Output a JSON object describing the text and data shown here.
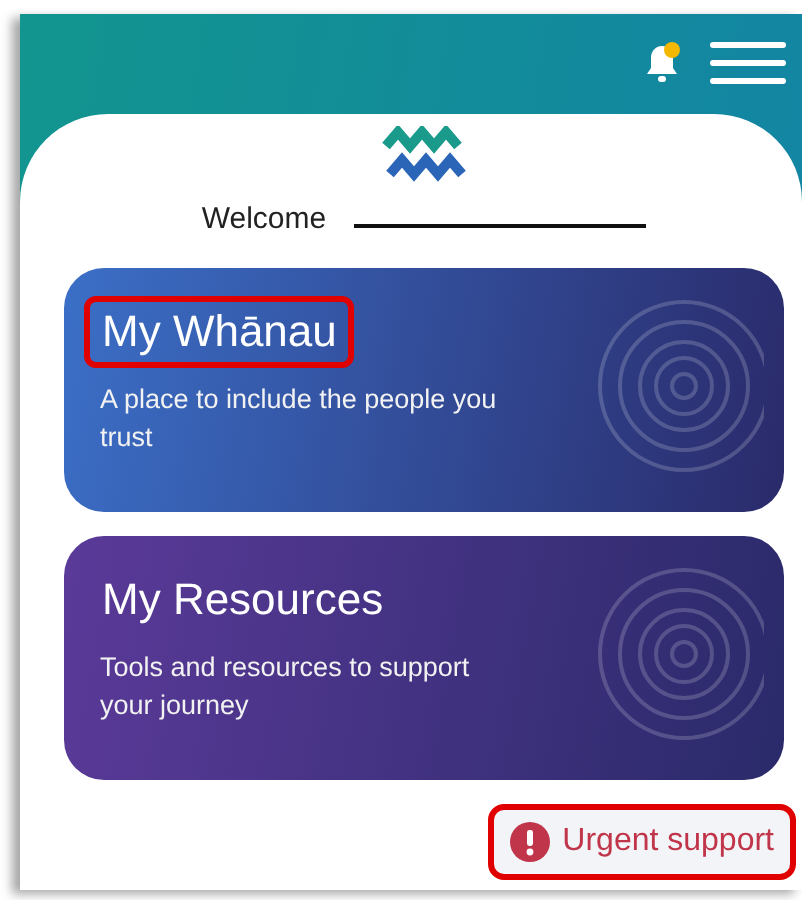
{
  "header": {
    "notification_badge": true
  },
  "welcome": {
    "label": "Welcome"
  },
  "cards": [
    {
      "title": "My Whānau",
      "subtitle": "A place to include the people you trust",
      "color": "#3b6fc7",
      "title_highlighted": true
    },
    {
      "title": "My Resources",
      "subtitle": "Tools and resources to support your journey",
      "color": "#5b3a99",
      "title_highlighted": false
    }
  ],
  "urgent_button": {
    "label": "Urgent support",
    "highlighted": true
  }
}
